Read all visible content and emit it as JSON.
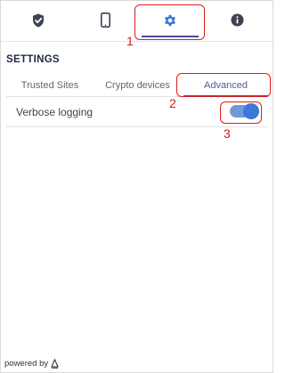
{
  "nav": {
    "tabs": [
      {
        "icon": "shield-check-icon",
        "active": false
      },
      {
        "icon": "phone-icon",
        "active": false
      },
      {
        "icon": "gear-icon",
        "active": true
      },
      {
        "icon": "info-icon",
        "active": false
      }
    ]
  },
  "settings": {
    "title": "SETTINGS",
    "subtabs": [
      "Trusted Sites",
      "Crypto devices",
      "Advanced"
    ],
    "active_subtab": "Advanced",
    "verbose_logging": {
      "label": "Verbose logging",
      "enabled": true
    }
  },
  "footer": {
    "text": "powered by",
    "logo": "delta-logo-icon"
  },
  "annotations": [
    "1",
    "2",
    "3"
  ],
  "colors": {
    "accent": "#4a4a9e",
    "toggle_on": "#3b78d8",
    "annotation": "#e01b1b",
    "icon": "#3d4350",
    "gear_active": "#3b78d8"
  }
}
